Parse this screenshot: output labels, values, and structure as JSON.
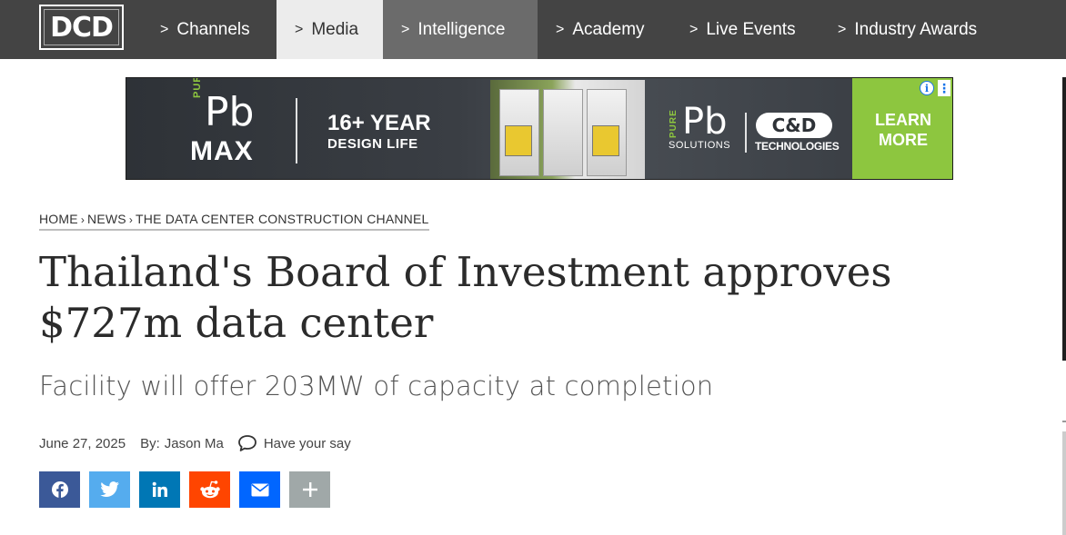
{
  "nav": {
    "logo": "DCD",
    "items": [
      {
        "label": "Channels",
        "chevron": ">"
      },
      {
        "label": "Media",
        "chevron": ">"
      },
      {
        "label": "Intelligence",
        "chevron": ">"
      },
      {
        "label": "Academy",
        "chevron": ">"
      },
      {
        "label": "Live Events",
        "chevron": ">"
      },
      {
        "label": "Industry Awards",
        "chevron": ">"
      }
    ]
  },
  "ad": {
    "pure": "PURE",
    "pb": "Pb",
    "max": "MAX",
    "year": "16+ YEAR",
    "life": "DESIGN LIFE",
    "pure2": "PURE",
    "pb2": "Pb",
    "solutions": "SOLUTIONS",
    "cd_logo": "C&D",
    "technologies": "TECHNOLOGIES",
    "cta_line1": "LEARN",
    "cta_line2": "MORE",
    "info": "i",
    "menu": "⋮"
  },
  "breadcrumb": {
    "home": "HOME",
    "news": "NEWS",
    "channel": "THE DATA CENTER CONSTRUCTION CHANNEL",
    "separator": "›"
  },
  "article": {
    "title": "Thailand's Board of Investment approves $727m data center",
    "subtitle": "Facility will offer 203MW of capacity at completion",
    "date": "June 27, 2025",
    "by_label": "By:",
    "author": "Jason Ma",
    "comment_label": "Have your say"
  },
  "share": [
    {
      "name": "facebook",
      "color": "#3b5998"
    },
    {
      "name": "twitter",
      "color": "#55acee"
    },
    {
      "name": "linkedin",
      "color": "#0077b5"
    },
    {
      "name": "reddit",
      "color": "#ff4500"
    },
    {
      "name": "email",
      "color": "#0166ff"
    },
    {
      "name": "more",
      "color": "#a0a8a8"
    }
  ],
  "colors": {
    "nav_bg": "#444444",
    "nav_active_bg": "#ececec",
    "nav_hover_bg": "#6b6b6b",
    "ad_cta_green": "#8dc63f"
  }
}
